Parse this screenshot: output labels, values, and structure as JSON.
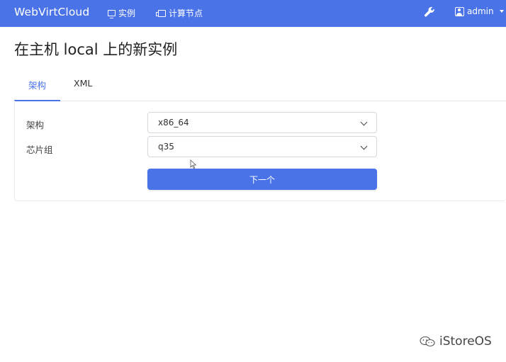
{
  "navbar": {
    "brand": "WebVirtCloud",
    "instances_label": "实例",
    "compute_label": "计算节点",
    "user_label": "admin",
    "accent_color": "#4a73e8"
  },
  "page": {
    "title": "在主机 local 上的新实例"
  },
  "tabs": [
    {
      "label": "架构",
      "active": true
    },
    {
      "label": "XML",
      "active": false
    }
  ],
  "form": {
    "arch_label": "架构",
    "arch_value": "x86_64",
    "chipset_label": "芯片组",
    "chipset_value": "q35",
    "next_label": "下一个"
  },
  "watermark": {
    "text": "iStoreOS"
  },
  "icons": [
    "monitor-icon",
    "server-icon",
    "wrench-icon",
    "user-icon",
    "caret-down-icon",
    "chevron-down-icon",
    "mouse-cursor-icon",
    "wechat-icon"
  ]
}
